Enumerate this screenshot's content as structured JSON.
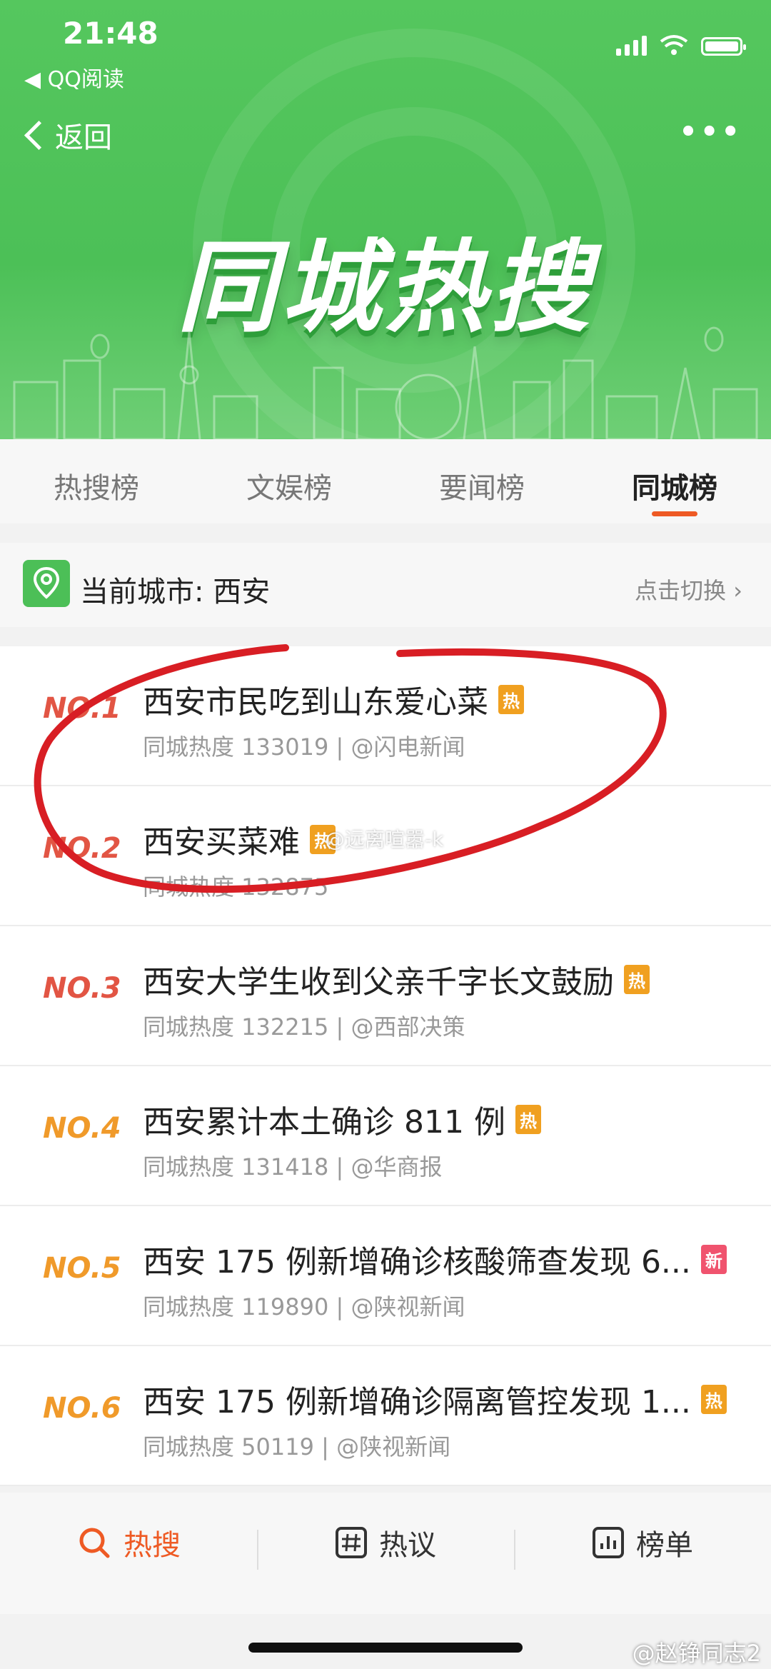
{
  "status_bar": {
    "time": "21:48",
    "back_app": "◀ QQ阅读"
  },
  "header": {
    "back_label": "返回",
    "more_label": "•••",
    "hero_title": "同城热搜"
  },
  "tabs": [
    {
      "label": "热搜榜",
      "active": false
    },
    {
      "label": "文娱榜",
      "active": false
    },
    {
      "label": "要闻榜",
      "active": false
    },
    {
      "label": "同城榜",
      "active": true
    }
  ],
  "city": {
    "label": "当前城市: 西安",
    "switch_label": "点击切换 ›"
  },
  "list": [
    {
      "rank": "NO.1",
      "title": "西安市民吃到山东爱心菜",
      "badge": "热",
      "badge_color": "#f0a020",
      "meta": "同城热度 133019 | @闪电新闻",
      "rank_color": "#e25544"
    },
    {
      "rank": "NO.2",
      "title": "西安买菜难",
      "badge": "热",
      "badge_color": "#f0a020",
      "meta": "同城热度 132875",
      "rank_color": "#e25544"
    },
    {
      "rank": "NO.3",
      "title": "西安大学生收到父亲千字长文鼓励",
      "badge": "热",
      "badge_color": "#f0a020",
      "meta": "同城热度 132215 | @西部决策",
      "rank_color": "#e25544"
    },
    {
      "rank": "NO.4",
      "title": "西安累计本土确诊 811 例",
      "badge": "热",
      "badge_color": "#f0a020",
      "meta": "同城热度 131418 | @华商报",
      "rank_color": "#f09a2a"
    },
    {
      "rank": "NO.5",
      "title": "西安 175 例新增确诊核酸筛查发现 6...",
      "badge": "新",
      "badge_color": "#f0536e",
      "meta": "同城热度 119890 | @陕视新闻",
      "rank_color": "#f09a2a"
    },
    {
      "rank": "NO.6",
      "title": "西安 175 例新增确诊隔离管控发现 1...",
      "badge": "热",
      "badge_color": "#f0a020",
      "meta": "同城热度 50119 | @陕视新闻",
      "rank_color": "#f09a2a"
    }
  ],
  "watermark_mid": "@远离喧嚣-k",
  "bottom_nav": [
    {
      "label": "热搜",
      "icon": "search-icon",
      "active": true
    },
    {
      "label": "热议",
      "icon": "hashtag-icon",
      "active": false
    },
    {
      "label": "榜单",
      "icon": "chart-icon",
      "active": false
    }
  ],
  "watermark_bottom": "@赵铮同志2",
  "colors": {
    "green": "#4cc057",
    "accent": "#ee5a24",
    "annotation": "#d81e24"
  }
}
